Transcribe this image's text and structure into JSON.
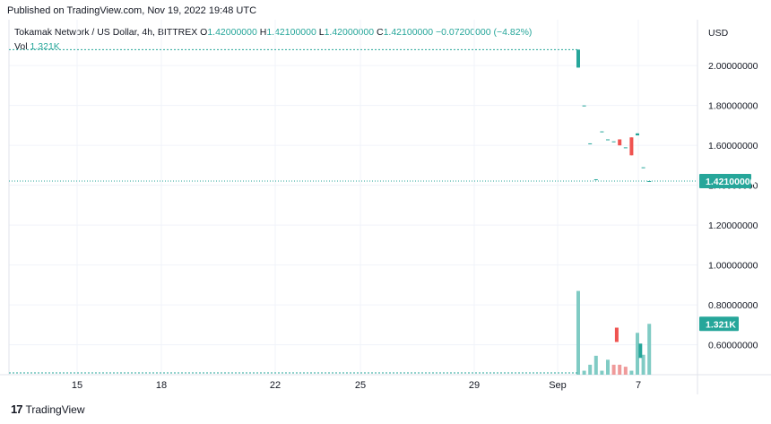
{
  "header": {
    "published": "Published on TradingView.com, Nov 19, 2022 19:48 UTC"
  },
  "legend": {
    "symbol": "Tokamak Network / US Dollar, 4h, BITTREX",
    "o_label": "O",
    "o_value": "1.42000000",
    "h_label": "H",
    "h_value": "1.42100000",
    "l_label": "L",
    "l_value": "1.42000000",
    "c_label": "C",
    "c_value": "1.42100000",
    "change": "−0.07200000 (−4.82%)",
    "vol_label": "Vol",
    "vol_value": "1.321K"
  },
  "footer": {
    "brand": "TradingView",
    "logo": "17"
  },
  "colors": {
    "up": "#26a69a",
    "down": "#ef5350",
    "vol_up": "#80cbc4",
    "vol_down": "#ef9a9a",
    "grid": "#f0f3fa",
    "axis_text": "#131722",
    "price_line": "#26a69a"
  },
  "chart_data": {
    "type": "candlestick",
    "currency": "USD",
    "y_ticks": [
      "2.00000000",
      "1.80000000",
      "1.60000000",
      "1.40000000",
      "1.20000000",
      "1.00000000",
      "0.80000000",
      "0.60000000"
    ],
    "ylim": [
      0.45,
      2.23
    ],
    "x_ticks": [
      "15",
      "18",
      "22",
      "25",
      "29",
      "Sep",
      "7"
    ],
    "last_price_label": "1.42100000",
    "last_price": 1.421,
    "last_volume_label": "1.321K",
    "last_volume_level": 0.705,
    "candles": [
      {
        "i": 0,
        "o": 1.99,
        "h": 2.08,
        "l": 1.99,
        "c": 2.08
      },
      {
        "i": 1,
        "o": 1.8,
        "h": 1.8,
        "l": 1.8,
        "c": 1.8
      },
      {
        "i": 2,
        "o": 1.61,
        "h": 1.61,
        "l": 1.61,
        "c": 1.61
      },
      {
        "i": 3,
        "o": 1.43,
        "h": 1.43,
        "l": 1.43,
        "c": 1.43
      },
      {
        "i": 4,
        "o": 1.67,
        "h": 1.67,
        "l": 1.67,
        "c": 1.67
      },
      {
        "i": 5,
        "o": 1.63,
        "h": 1.63,
        "l": 1.63,
        "c": 1.63
      },
      {
        "i": 6,
        "o": 1.62,
        "h": 1.62,
        "l": 1.62,
        "c": 1.62
      },
      {
        "i": 7,
        "o": 1.63,
        "h": 1.63,
        "l": 1.6,
        "c": 1.6
      },
      {
        "i": 8,
        "o": 1.59,
        "h": 1.59,
        "l": 1.59,
        "c": 1.59
      },
      {
        "i": 9,
        "o": 1.64,
        "h": 1.64,
        "l": 1.55,
        "c": 1.55
      },
      {
        "i": 10,
        "o": 1.65,
        "h": 1.66,
        "l": 1.65,
        "c": 1.66
      },
      {
        "i": 11,
        "o": 1.49,
        "h": 1.49,
        "l": 1.49,
        "c": 1.49
      },
      {
        "i": 12,
        "o": 1.42,
        "h": 1.421,
        "l": 1.42,
        "c": 1.421
      }
    ],
    "volume": [
      {
        "i": 0,
        "level": 0.87,
        "up": true
      },
      {
        "i": 1,
        "level": 0.47,
        "up": true
      },
      {
        "i": 2,
        "level": 0.5,
        "up": true
      },
      {
        "i": 3,
        "level": 0.545,
        "up": true
      },
      {
        "i": 4,
        "level": 0.47,
        "up": true
      },
      {
        "i": 5,
        "level": 0.525,
        "up": true
      },
      {
        "i": 6,
        "level": 0.5,
        "up": false
      },
      {
        "i": 7,
        "level": 0.5,
        "up": false
      },
      {
        "i": 8,
        "level": 0.49,
        "up": false
      },
      {
        "i": 9,
        "level": 0.47,
        "up": true
      },
      {
        "i": 10,
        "level": 0.66,
        "up": true
      },
      {
        "i": 11,
        "level": 0.55,
        "up": true
      },
      {
        "i": 12,
        "level": 0.705,
        "up": true
      }
    ],
    "vol_markers": [
      {
        "i": 6.5,
        "level": 0.65,
        "up": false
      },
      {
        "i": 10.5,
        "level": 0.57,
        "up": true
      }
    ]
  }
}
